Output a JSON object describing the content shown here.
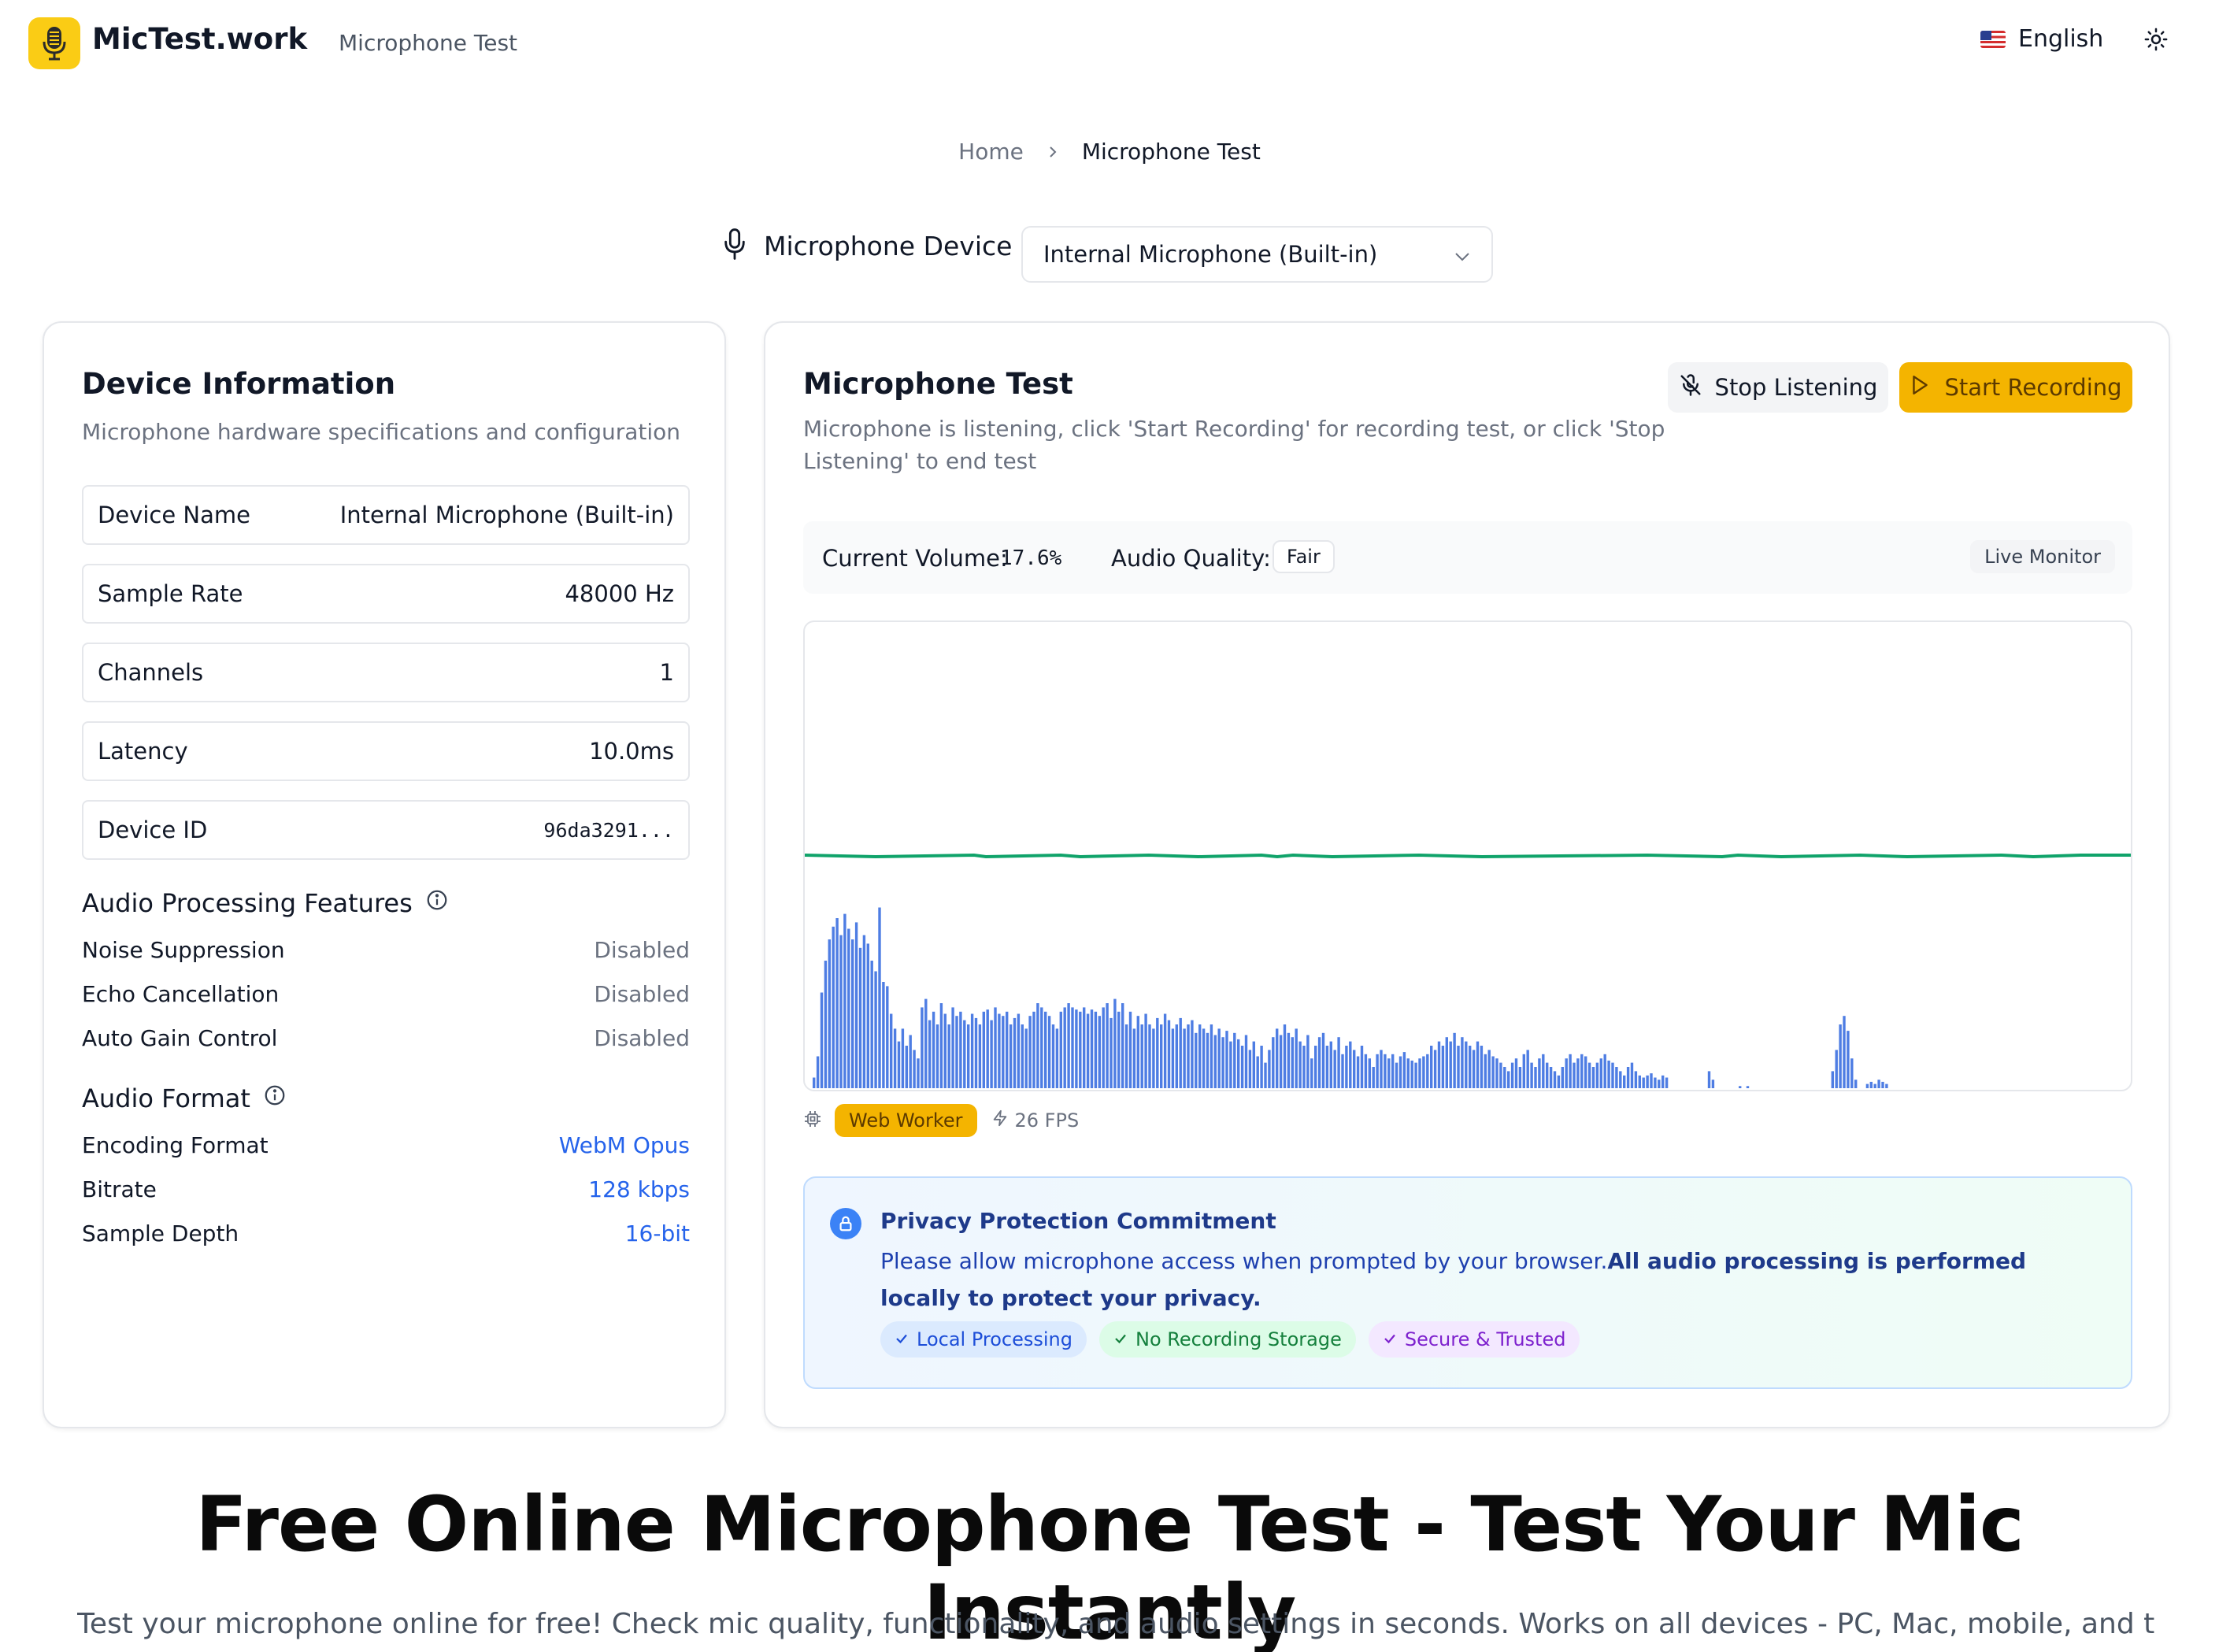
{
  "header": {
    "brand": "MicTest.work",
    "nav_link": "Microphone Test",
    "language": "English"
  },
  "breadcrumb": {
    "home": "Home",
    "current": "Microphone Test"
  },
  "device_selector": {
    "label": "Microphone Device",
    "selected": "Internal Microphone (Built-in)"
  },
  "device_info": {
    "title": "Device Information",
    "subtitle": "Microphone hardware specifications and configuration",
    "rows": [
      {
        "label": "Device Name",
        "value": "Internal Microphone (Built-in)"
      },
      {
        "label": "Sample Rate",
        "value": "48000 Hz"
      },
      {
        "label": "Channels",
        "value": "1"
      },
      {
        "label": "Latency",
        "value": "10.0ms"
      },
      {
        "label": "Device ID",
        "value": "96da3291..."
      }
    ],
    "processing": {
      "title": "Audio Processing Features",
      "items": [
        {
          "label": "Noise Suppression",
          "value": "Disabled"
        },
        {
          "label": "Echo Cancellation",
          "value": "Disabled"
        },
        {
          "label": "Auto Gain Control",
          "value": "Disabled"
        }
      ]
    },
    "format": {
      "title": "Audio Format",
      "items": [
        {
          "label": "Encoding Format",
          "value": "WebM Opus"
        },
        {
          "label": "Bitrate",
          "value": "128 kbps"
        },
        {
          "label": "Sample Depth",
          "value": "16-bit"
        }
      ]
    }
  },
  "mic_test": {
    "title": "Microphone Test",
    "subtitle_line1": "Microphone is listening, click 'Start Recording' for recording test, or click 'Stop",
    "subtitle_line2": "Listening' to end test",
    "stop_label": "Stop Listening",
    "record_label": "Start Recording",
    "volume_label": "Current Volume:",
    "volume_value": "17.6%",
    "quality_label": "Audio Quality:",
    "quality_value": "Fair",
    "live_label": "Live Monitor",
    "worker_label": "Web Worker",
    "fps_label": "26 FPS",
    "colors": {
      "wave": "#10a36a",
      "bars": "#3b6fe0",
      "accent": "#f4b400"
    },
    "spectrum": [
      0.05,
      0.15,
      0.45,
      0.6,
      0.7,
      0.76,
      0.8,
      0.72,
      0.82,
      0.75,
      0.7,
      0.78,
      0.66,
      0.72,
      0.68,
      0.6,
      0.55,
      0.85,
      0.5,
      0.48,
      0.35,
      0.28,
      0.22,
      0.28,
      0.2,
      0.25,
      0.18,
      0.14,
      0.38,
      0.42,
      0.32,
      0.36,
      0.3,
      0.4,
      0.35,
      0.3,
      0.38,
      0.34,
      0.36,
      0.32,
      0.3,
      0.35,
      0.33,
      0.3,
      0.36,
      0.37,
      0.32,
      0.38,
      0.35,
      0.34,
      0.36,
      0.3,
      0.33,
      0.35,
      0.3,
      0.28,
      0.34,
      0.36,
      0.4,
      0.38,
      0.36,
      0.34,
      0.3,
      0.28,
      0.36,
      0.38,
      0.4,
      0.38,
      0.37,
      0.36,
      0.38,
      0.35,
      0.37,
      0.36,
      0.34,
      0.38,
      0.4,
      0.33,
      0.42,
      0.36,
      0.4,
      0.3,
      0.36,
      0.28,
      0.34,
      0.3,
      0.35,
      0.3,
      0.28,
      0.33,
      0.3,
      0.35,
      0.32,
      0.28,
      0.3,
      0.33,
      0.28,
      0.3,
      0.32,
      0.26,
      0.3,
      0.28,
      0.26,
      0.3,
      0.25,
      0.28,
      0.24,
      0.27,
      0.22,
      0.26,
      0.23,
      0.2,
      0.25,
      0.18,
      0.22,
      0.15,
      0.2,
      0.12,
      0.18,
      0.24,
      0.28,
      0.25,
      0.3,
      0.26,
      0.24,
      0.28,
      0.22,
      0.2,
      0.25,
      0.14,
      0.2,
      0.24,
      0.26,
      0.2,
      0.22,
      0.18,
      0.24,
      0.16,
      0.2,
      0.22,
      0.18,
      0.15,
      0.2,
      0.16,
      0.14,
      0.1,
      0.16,
      0.18,
      0.16,
      0.14,
      0.16,
      0.12,
      0.15,
      0.17,
      0.14,
      0.13,
      0.12,
      0.14,
      0.15,
      0.16,
      0.2,
      0.18,
      0.22,
      0.2,
      0.24,
      0.22,
      0.26,
      0.2,
      0.24,
      0.22,
      0.2,
      0.18,
      0.22,
      0.2,
      0.16,
      0.18,
      0.15,
      0.14,
      0.12,
      0.1,
      0.08,
      0.12,
      0.14,
      0.1,
      0.16,
      0.18,
      0.12,
      0.1,
      0.14,
      0.16,
      0.12,
      0.1,
      0.08,
      0.06,
      0.1,
      0.14,
      0.16,
      0.12,
      0.14,
      0.16,
      0.15,
      0.12,
      0.1,
      0.12,
      0.14,
      0.16,
      0.13,
      0.12,
      0.1,
      0.08,
      0.06,
      0.1,
      0.12,
      0.08,
      0.06,
      0.05,
      0.06,
      0.07,
      0.05,
      0.04,
      0.06,
      0.05,
      0.0,
      0.0,
      0.0,
      0.0,
      0.0,
      0.0,
      0.0,
      0.0,
      0.0,
      0.0,
      0.08,
      0.04,
      0.0,
      0.0,
      0.0,
      0.0,
      0.0,
      0.0,
      0.01,
      0.0,
      0.01,
      0.0,
      0.0,
      0.0,
      0.0,
      0.0,
      0.0,
      0.0,
      0.0,
      0.0,
      0.0,
      0.0,
      0.0,
      0.0,
      0.0,
      0.0,
      0.0,
      0.0,
      0.0,
      0.0,
      0.0,
      0.0,
      0.08,
      0.18,
      0.3,
      0.34,
      0.27,
      0.14,
      0.04,
      0.0,
      0.0,
      0.02,
      0.03,
      0.02,
      0.04,
      0.03,
      0.02
    ]
  },
  "privacy": {
    "title": "Privacy Protection Commitment",
    "text_plain": "Please allow microphone access when prompted by your browser.",
    "text_bold": "All audio processing is performed locally to protect your privacy.",
    "tags": [
      "Local Processing",
      "No Recording Storage",
      "Secure & Trusted"
    ]
  },
  "hero": {
    "title": "Free Online Microphone Test - Test Your Mic Instantly",
    "subtitle": "Test your microphone online for free! Check mic quality, functionality, and audio settings in seconds. Works on all devices - PC, Mac, mobile, and tablets. No"
  }
}
